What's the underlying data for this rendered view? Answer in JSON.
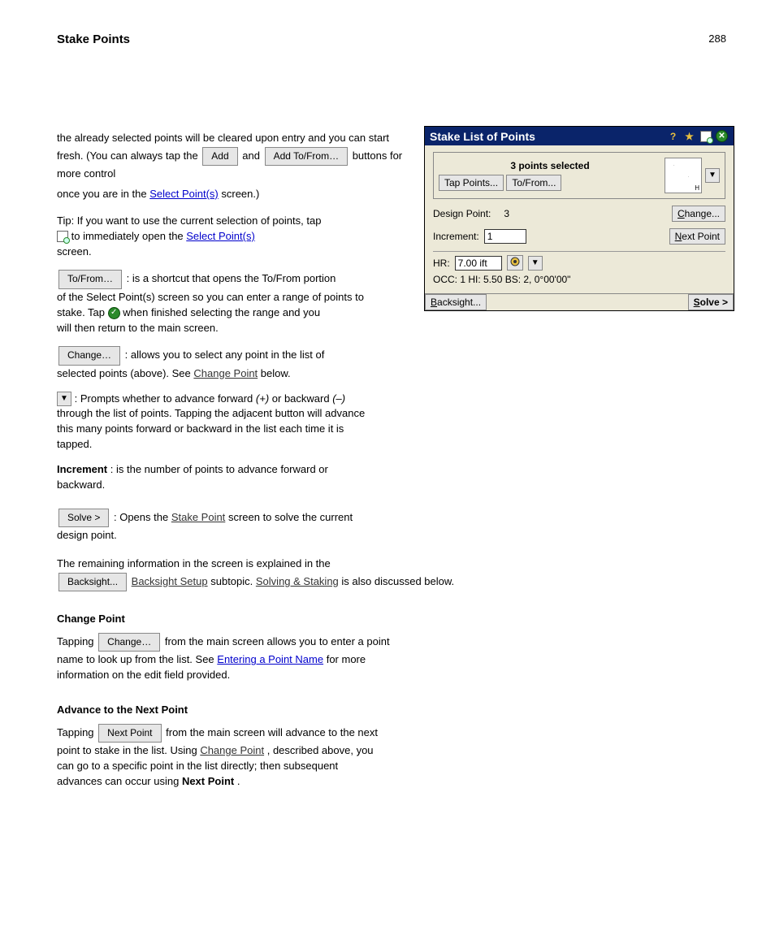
{
  "page": {
    "title": "Stake Points",
    "number": "288"
  },
  "intro1_a": "the already selected points will be cleared upon entry and you can start fresh. (You can always tap the ",
  "intro1_btn1": "Add",
  "intro1_mid": " and ",
  "intro1_btn2": "Add To/From…",
  "intro1_end": " buttons for more control",
  "intro2": "once you are in the ",
  "intro2_link": "Select Point(s)",
  "intro2_end": " screen.)",
  "note1_pre": "Tip: If you want to use the current selection of points, tap ",
  "note1_end": " to immediately open the ",
  "note1_link": "Select Point(s)",
  "note1_b": " screen.",
  "to_from_btn": "To/From…",
  "to_from_text": ": is a shortcut that opens the To/From portion",
  "para_tofrom2": "of the Select Point(s) screen so you can enter a range of points to",
  "para_tofrom3a": "stake. Tap ",
  "para_tofrom3b": " when finished selecting the range and you",
  "para_tofrom4": "will then return to the main screen.",
  "change_btn": "Change…",
  "change_text": ": allows you to select any point in the list of",
  "change_text2a": "selected points (above). See ",
  "change_link": "Change Point",
  "change_text2b": " below.",
  "dd_text": ": Prompts whether to advance forward ",
  "dd_i": "(+)",
  "dd_text2": " or backward ",
  "dd_i2": "(–)",
  "dd_text3": "through the list of points. Tapping the adjacent button will advance",
  "dd_text4": "this many points forward or backward in the list each time it is",
  "dd_text5": "tapped.",
  "inc_label": "Increment",
  "inc_text": ": is the number of points to advance forward or",
  "inc_text2": "backward.",
  "solve_btn": "Solve >",
  "solve_text": ": Opens the ",
  "solve_link": "Stake Point",
  "solve_text2": " screen to solve the current",
  "solve_text3": "design point.",
  "solve_text4a": "The remaining information in the screen is explained in the",
  "solve_text4link": "Backsight Setup",
  "solve_text4b": " subtopic. ",
  "solve_text4link2": "Solving & Staking",
  "solve_text4c": " is also discussed below.",
  "h2_1": "Change Point",
  "cp1a": "Tapping ",
  "cp_btn": "Change…",
  "cp1b": " from the main screen allows you to enter a point",
  "cp2a": "name to look up from the list. See ",
  "cp2_link": "Entering a Point Name",
  "cp2b": " for more",
  "cp3": "information on the edit field provided.",
  "h2_2": "Advance to the Next Point",
  "np1a": "Tapping ",
  "np_btn": "Next Point",
  "np1b": " from the main screen will advance to the next",
  "np2a": "point to stake in the list. Using ",
  "np2_link": "Change Point",
  "np2b": ", described above, you",
  "np3": "can go to a specific point in the list directly; then subsequent",
  "np4a": "advances can occur using ",
  "np4b": "Next Point",
  "np4c": ".",
  "figure": {
    "title": "Stake List of Points",
    "summary": "3 points selected",
    "tap_btn": "Tap Points...",
    "tofrom_btn": "To/From...",
    "preview_label": "H",
    "design_label": "Design Point:",
    "design_val": "3",
    "change_btn": "Change...",
    "change_ul": "C",
    "inc_label": "Increment:",
    "inc_val": "1",
    "next_btn": "ext Point",
    "next_ul": "N",
    "hr_label": "HR:",
    "hr_val": "7.00 ift",
    "status": "OCC: 1   HI: 5.50   BS: 2, 0°00'00\"",
    "backsight_btn": "acksight...",
    "backsight_ul": "B",
    "solve_btn": "olve >",
    "solve_ul": "S"
  }
}
